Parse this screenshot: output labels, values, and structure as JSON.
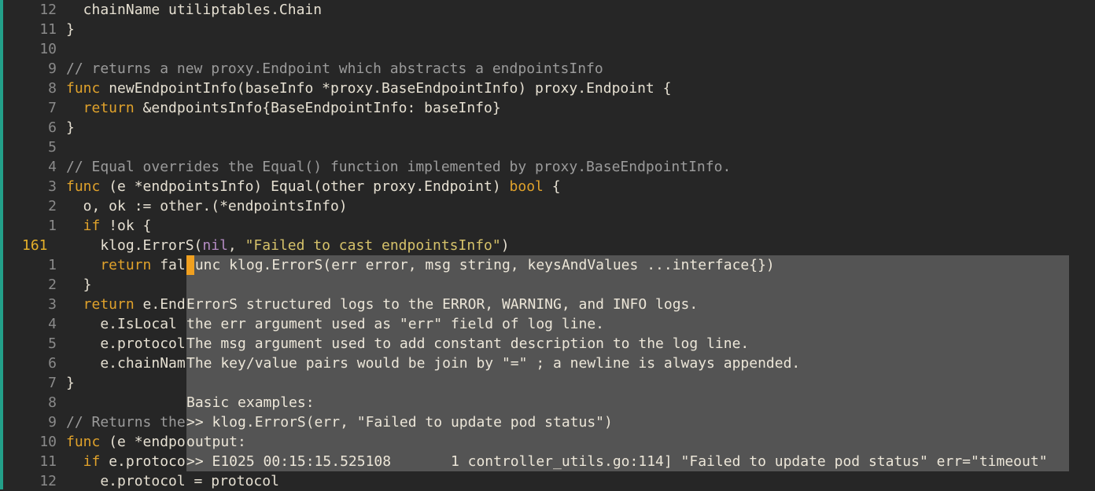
{
  "editor": {
    "lines": [
      {
        "num": "12",
        "current": false,
        "tokens": [
          {
            "t": "  chainName utiliptables.Chain",
            "c": "plain"
          }
        ]
      },
      {
        "num": "11",
        "current": false,
        "tokens": [
          {
            "t": "}",
            "c": "plain"
          }
        ]
      },
      {
        "num": "10",
        "current": false,
        "tokens": []
      },
      {
        "num": "9",
        "current": false,
        "tokens": [
          {
            "t": "// returns a new proxy.Endpoint which abstracts a endpointsInfo",
            "c": "com"
          }
        ]
      },
      {
        "num": "8",
        "current": false,
        "tokens": [
          {
            "t": "func",
            "c": "key"
          },
          {
            "t": " newEndpointInfo(baseInfo *proxy.BaseEndpointInfo) proxy.Endpoint {",
            "c": "plain"
          }
        ]
      },
      {
        "num": "7",
        "current": false,
        "tokens": [
          {
            "t": "  return",
            "c": "key"
          },
          {
            "t": " &endpointsInfo{BaseEndpointInfo: baseInfo}",
            "c": "plain"
          }
        ]
      },
      {
        "num": "6",
        "current": false,
        "tokens": [
          {
            "t": "}",
            "c": "plain"
          }
        ]
      },
      {
        "num": "5",
        "current": false,
        "tokens": []
      },
      {
        "num": "4",
        "current": false,
        "tokens": [
          {
            "t": "// Equal overrides the Equal() function implemented by proxy.BaseEndpointInfo.",
            "c": "com"
          }
        ]
      },
      {
        "num": "3",
        "current": false,
        "tokens": [
          {
            "t": "func",
            "c": "key"
          },
          {
            "t": " (e *endpointsInfo) Equal(other proxy.Endpoint) ",
            "c": "plain"
          },
          {
            "t": "bool",
            "c": "type"
          },
          {
            "t": " {",
            "c": "plain"
          }
        ]
      },
      {
        "num": "2",
        "current": false,
        "tokens": [
          {
            "t": "  o, ok := other.(*endpointsInfo)",
            "c": "plain"
          }
        ]
      },
      {
        "num": "1",
        "current": false,
        "tokens": [
          {
            "t": "  if",
            "c": "key"
          },
          {
            "t": " !ok {",
            "c": "plain"
          }
        ]
      },
      {
        "num": "161",
        "current": true,
        "tokens": [
          {
            "t": "    klog.ErrorS(",
            "c": "plain"
          },
          {
            "t": "nil",
            "c": "nil"
          },
          {
            "t": ", ",
            "c": "plain"
          },
          {
            "t": "\"Failed to cast endpointsInfo\"",
            "c": "str"
          },
          {
            "t": ")",
            "c": "plain"
          }
        ]
      },
      {
        "num": "1",
        "current": false,
        "tokens": [
          {
            "t": "    return",
            "c": "key"
          },
          {
            "t": " fal",
            "c": "plain"
          }
        ]
      },
      {
        "num": "2",
        "current": false,
        "tokens": [
          {
            "t": "  }",
            "c": "plain"
          }
        ]
      },
      {
        "num": "3",
        "current": false,
        "tokens": [
          {
            "t": "  return",
            "c": "key"
          },
          {
            "t": " e.End",
            "c": "plain"
          }
        ]
      },
      {
        "num": "4",
        "current": false,
        "tokens": [
          {
            "t": "    e.IsLocal",
            "c": "plain"
          }
        ]
      },
      {
        "num": "5",
        "current": false,
        "tokens": [
          {
            "t": "    e.protocol",
            "c": "plain"
          }
        ]
      },
      {
        "num": "6",
        "current": false,
        "tokens": [
          {
            "t": "    e.chainNam",
            "c": "plain"
          }
        ]
      },
      {
        "num": "7",
        "current": false,
        "tokens": [
          {
            "t": "}",
            "c": "plain"
          }
        ]
      },
      {
        "num": "8",
        "current": false,
        "tokens": []
      },
      {
        "num": "9",
        "current": false,
        "tokens": [
          {
            "t": "// Returns the",
            "c": "com"
          }
        ]
      },
      {
        "num": "10",
        "current": false,
        "tokens": [
          {
            "t": "func",
            "c": "key"
          },
          {
            "t": " (e *endpo",
            "c": "plain"
          }
        ]
      },
      {
        "num": "11",
        "current": false,
        "tokens": [
          {
            "t": "  if",
            "c": "key"
          },
          {
            "t": " e.protoco",
            "c": "plain"
          }
        ]
      },
      {
        "num": "12",
        "current": false,
        "tokens": [
          {
            "t": "    e.protocol = protocol",
            "c": "plain"
          }
        ]
      }
    ]
  },
  "hover_popup": {
    "lines": [
      "func klog.ErrorS(err error, msg string, keysAndValues ...interface{})",
      "",
      "ErrorS structured logs to the ERROR, WARNING, and INFO logs.",
      "the err argument used as \"err\" field of log line.",
      "The msg argument used to add constant description to the log line.",
      "The key/value pairs would be join by \"=\" ; a newline is always appended.",
      "",
      "Basic examples:",
      ">> klog.ErrorS(err, \"Failed to update pod status\")",
      "output:",
      ">> E1025 00:15:15.525108       1 controller_utils.go:114] \"Failed to update pod status\" err=\"timeout\""
    ]
  },
  "cursor_char": "f",
  "colors": {
    "background": "#262626",
    "popup_bg": "#545454",
    "keyword": "#e0a22b",
    "string": "#d6c26a",
    "comment": "#9b9b9b",
    "nil": "#b58cc4",
    "current_line_number": "#e5b02a",
    "cursor": "#f0a020",
    "left_border": "#23a08a"
  }
}
